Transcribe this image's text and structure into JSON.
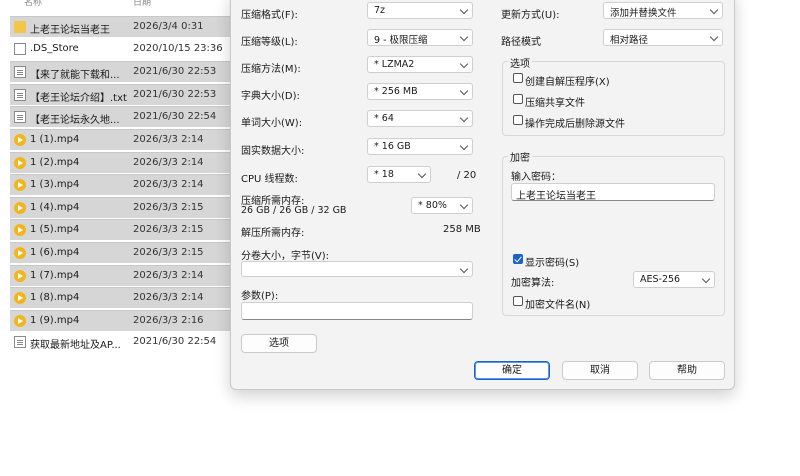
{
  "filelist": {
    "header": {
      "name": "名称",
      "date": "日期"
    },
    "rows": [
      {
        "icon": "folder",
        "name": "上老王论坛当老王",
        "date": "2026/3/4 0:31",
        "selected": true
      },
      {
        "icon": "blank",
        "name": ".DS_Store",
        "date": "2020/10/15 23:36",
        "selected": false
      },
      {
        "icon": "doc",
        "name": "【来了就能下载和...",
        "date": "2021/6/30 22:53",
        "selected": true
      },
      {
        "icon": "doc",
        "name": "【老王论坛介绍】.txt",
        "date": "2021/6/30 22:53",
        "selected": true
      },
      {
        "icon": "doc",
        "name": "【老王论坛永久地...",
        "date": "2021/6/30 22:54",
        "selected": true
      },
      {
        "icon": "mp4",
        "name": "1 (1).mp4",
        "date": "2026/3/3 2:14",
        "selected": true
      },
      {
        "icon": "mp4",
        "name": "1 (2).mp4",
        "date": "2026/3/3 2:14",
        "selected": true
      },
      {
        "icon": "mp4",
        "name": "1 (3).mp4",
        "date": "2026/3/3 2:14",
        "selected": true
      },
      {
        "icon": "mp4",
        "name": "1 (4).mp4",
        "date": "2026/3/3 2:15",
        "selected": true
      },
      {
        "icon": "mp4",
        "name": "1 (5).mp4",
        "date": "2026/3/3 2:15",
        "selected": true
      },
      {
        "icon": "mp4",
        "name": "1 (6).mp4",
        "date": "2026/3/3 2:15",
        "selected": true
      },
      {
        "icon": "mp4",
        "name": "1 (7).mp4",
        "date": "2026/3/3 2:14",
        "selected": true
      },
      {
        "icon": "mp4",
        "name": "1 (8).mp4",
        "date": "2026/3/3 2:14",
        "selected": true
      },
      {
        "icon": "mp4",
        "name": "1 (9).mp4",
        "date": "2026/3/3 2:16",
        "selected": true
      },
      {
        "icon": "doc",
        "name": "获取最新地址及AP...",
        "date": "2021/6/30 22:54",
        "selected": false
      }
    ]
  },
  "dialog": {
    "format": {
      "label": "压缩格式(F):",
      "value": "7z"
    },
    "level": {
      "label": "压缩等级(L):",
      "value": "9 - 极限压缩"
    },
    "method": {
      "label": "压缩方法(M):",
      "value": "* LZMA2"
    },
    "dict": {
      "label": "字典大小(D):",
      "value": "* 256 MB"
    },
    "word": {
      "label": "单词大小(W):",
      "value": "* 64"
    },
    "solid": {
      "label": "固实数据大小:",
      "value": "* 16 GB"
    },
    "threads": {
      "label": "CPU 线程数:",
      "value": "* 18",
      "max": "/ 20"
    },
    "mem": {
      "label": "压缩所需内存:",
      "detail": "26 GB / 26 GB / 32 GB",
      "value": "* 80%"
    },
    "decomp": {
      "label": "解压所需内存:",
      "value": "258 MB"
    },
    "volume": {
      "label": "分卷大小，字节(V):",
      "value": ""
    },
    "params": {
      "label": "参数(P):",
      "value": ""
    },
    "options_button": "选项",
    "update": {
      "label": "更新方式(U):",
      "value": "添加并替换文件"
    },
    "path": {
      "label": "路径模式",
      "value": "相对路径"
    },
    "options": {
      "title": "选项",
      "items": [
        {
          "label": "创建自解压程序(X)",
          "checked": false
        },
        {
          "label": "压缩共享文件",
          "checked": false
        },
        {
          "label": "操作完成后删除源文件",
          "checked": false
        }
      ]
    },
    "encrypt": {
      "title": "加密",
      "pw_label": "输入密码：",
      "pw_value": "上老王论坛当老王",
      "show_pw": {
        "label": "显示密码(S)",
        "checked": true
      },
      "algo_label": "加密算法:",
      "algo_value": "AES-256",
      "enc_names": {
        "label": "加密文件名(N)",
        "checked": false
      }
    },
    "buttons": {
      "ok": "确定",
      "cancel": "取消",
      "help": "帮助"
    }
  }
}
